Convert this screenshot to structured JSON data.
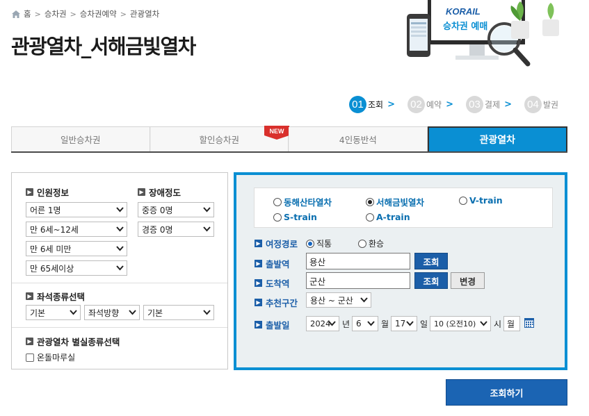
{
  "breadcrumb": {
    "home": "홈",
    "items": [
      "승차권",
      "승차권예약",
      "관광열차"
    ]
  },
  "page_title": "관광열차_서해금빛열차",
  "banner": {
    "brand": "KORAIL",
    "caption": "승차권 예매"
  },
  "steps": [
    {
      "num": "01",
      "label": "조회",
      "active": true
    },
    {
      "num": "02",
      "label": "예약",
      "active": false
    },
    {
      "num": "03",
      "label": "결제",
      "active": false
    },
    {
      "num": "04",
      "label": "발권",
      "active": false
    }
  ],
  "tabs": [
    {
      "label": "일반승차권",
      "active": false
    },
    {
      "label": "할인승차권",
      "active": false,
      "badge": "NEW"
    },
    {
      "label": "4인동반석",
      "active": false
    },
    {
      "label": "관광열차",
      "active": true
    }
  ],
  "passenger": {
    "title": "인원정보",
    "selects": [
      "어른 1명",
      "만 6세~12세",
      "만 6세 미만",
      "만 65세이상"
    ]
  },
  "disability": {
    "title": "장애정도",
    "selects": [
      "중증 0명",
      "경증 0명"
    ]
  },
  "seat_type": {
    "title": "좌석종류선택",
    "selects": [
      "기본",
      "좌석방향",
      "기본"
    ]
  },
  "room_type": {
    "title": "관광열차 별실종류선택",
    "checkbox_label": "온돌마루실",
    "checked": false
  },
  "trains": [
    {
      "label": "동해산타열차",
      "checked": false
    },
    {
      "label": "서해금빛열차",
      "checked": true
    },
    {
      "label": "V-train",
      "checked": false
    },
    {
      "label": "S-train",
      "checked": false
    },
    {
      "label": "A-train",
      "checked": false
    }
  ],
  "route": {
    "label": "여정경로",
    "options": [
      {
        "label": "직통",
        "checked": true
      },
      {
        "label": "환승",
        "checked": false
      }
    ]
  },
  "departure": {
    "label": "출발역",
    "value": "용산",
    "button": "조회"
  },
  "arrival": {
    "label": "도착역",
    "value": "군산",
    "button": "조회",
    "change_button": "변경"
  },
  "recommended": {
    "label": "추천구간",
    "value": "용산 ~ 군산"
  },
  "date": {
    "label": "출발일",
    "year": "2024",
    "year_unit": "년",
    "month": "6",
    "month_unit": "월",
    "day": "17",
    "day_unit": "일",
    "hour": "10 (오전10)",
    "hour_unit": "시",
    "weekday": "월"
  },
  "search_button": "조회하기",
  "colors": {
    "accent": "#0a8fd3",
    "button_blue": "#1b5ea8",
    "label_blue": "#1b5ea8",
    "badge_red": "#d9302c"
  }
}
